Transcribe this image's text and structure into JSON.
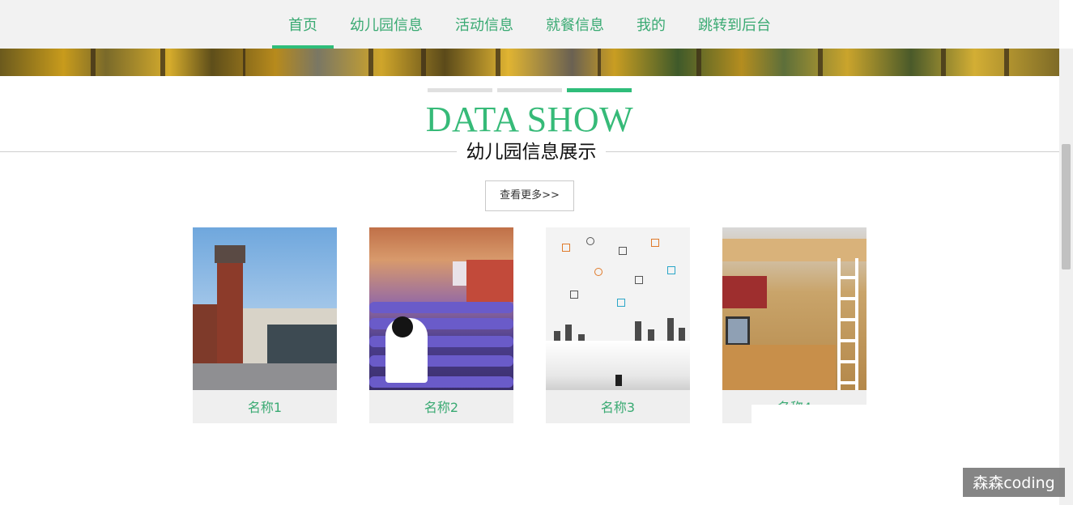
{
  "nav": {
    "items": [
      {
        "label": "首页",
        "active": true
      },
      {
        "label": "幼儿园信息",
        "active": false
      },
      {
        "label": "活动信息",
        "active": false
      },
      {
        "label": "就餐信息",
        "active": false
      },
      {
        "label": "我的",
        "active": false
      },
      {
        "label": "跳转到后台",
        "active": false
      }
    ]
  },
  "section": {
    "title_en": "DATA SHOW",
    "title_cn": "幼儿园信息展示",
    "more_label": "查看更多>>"
  },
  "cards": [
    {
      "name": "名称1",
      "image": "building-photo"
    },
    {
      "name": "名称2",
      "image": "auditorium-photo"
    },
    {
      "name": "名称3",
      "image": "infographic-book-illustration"
    },
    {
      "name": "名称4",
      "image": "dorm-room-photo"
    }
  ],
  "watermark": "森森coding",
  "colors": {
    "accent": "#2fbd7a",
    "nav_text": "#3aaa73",
    "nav_bg": "#f2f2f2",
    "card_bg": "#efefef"
  }
}
